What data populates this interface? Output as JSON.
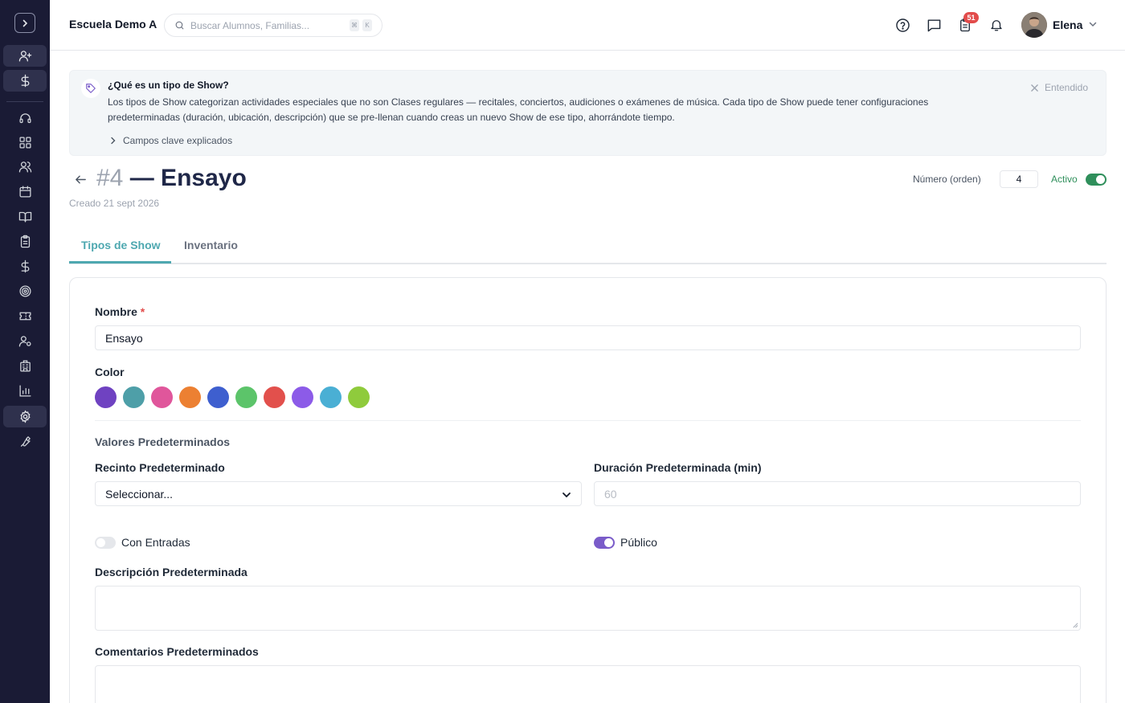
{
  "header": {
    "school_name": "Escuela Demo A",
    "search_placeholder": "Buscar Alumnos, Familias...",
    "kbd_1": "⌘",
    "kbd_2": "K",
    "notification_count": "51",
    "user_name": "Elena"
  },
  "info": {
    "title": "¿Qué es un tipo de Show?",
    "body": "Los tipos de Show categorizan actividades especiales que no son Clases regulares — recitales, conciertos, audiciones o exámenes de música. Cada tipo de Show puede tener configuraciones predeterminadas (duración, ubicación, descripción) que se pre-llenan cuando creas un nuevo Show de ese tipo, ahorrándote tiempo.",
    "more_label": "Campos clave explicados",
    "dismiss_label": "Entendido"
  },
  "page": {
    "number": "#4",
    "title": "— Ensayo",
    "created": "Creado 21 sept 2026",
    "order_label": "Número (orden)",
    "order_value": "4",
    "active_label": "Activo",
    "active": true
  },
  "tabs": [
    {
      "label": "Tipos de Show",
      "active": true
    },
    {
      "label": "Inventario",
      "active": false
    }
  ],
  "form": {
    "name_label": "Nombre",
    "required_mark": "*",
    "name_value": "Ensayo",
    "color_label": "Color",
    "colors": [
      "#6f42c1",
      "#4e9fa8",
      "#e0569b",
      "#ec8032",
      "#3e5fcf",
      "#5cc46a",
      "#e2504c",
      "#8c5be8",
      "#4aafd4",
      "#8fcb3c"
    ],
    "defaults_section": "Valores Predeterminados",
    "venue_label": "Recinto Predeterminado",
    "venue_value": "Seleccionar...",
    "duration_label": "Duración Predeterminada (min)",
    "duration_placeholder": "60",
    "tickets_label": "Con Entradas",
    "tickets_on": false,
    "public_label": "Público",
    "public_on": true,
    "description_label": "Descripción Predeterminada",
    "comments_label": "Comentarios Predeterminados"
  },
  "theme": {
    "accent": "#4ea8b0",
    "sidebar_bg": "#1a1b35",
    "active_green": "#2f8f5b",
    "purple": "#7a5cc9"
  }
}
